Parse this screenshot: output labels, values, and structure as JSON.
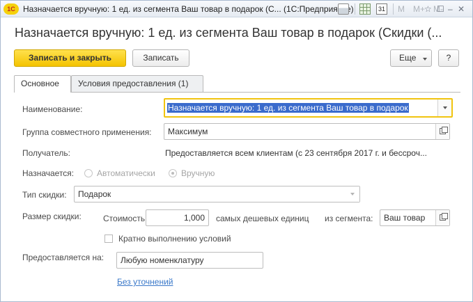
{
  "window": {
    "title": "Назначается вручную: 1 ед. из сегмента Ваш товар в подарок (С...  (1С:Предприятие)",
    "app_logo": "1С",
    "toolbar_icons": [
      "print-icon",
      "grid-icon",
      "calendar-icon"
    ],
    "calendar_day": "31",
    "memory_buttons": [
      "M",
      "M+",
      "M-"
    ],
    "system_buttons": [
      "☆",
      "☐",
      "–",
      "□",
      "✕"
    ]
  },
  "form": {
    "title": "Назначается вручную: 1 ед. из сегмента Ваш товар в подарок (Скидки (..."
  },
  "toolbar": {
    "save_close_label": "Записать и закрыть",
    "save_label": "Записать",
    "more_label": "Еще",
    "help_label": "?"
  },
  "tabs": [
    {
      "label": "Основное",
      "active": true
    },
    {
      "label": "Условия предоставления (1)",
      "active": false
    }
  ],
  "fields": {
    "name_label": "Наименование:",
    "name_value": "Назначается вручную: 1 ед. из сегмента Ваш товар в подарок",
    "group_label": "Группа совместного применения:",
    "group_value": "Максимум",
    "recipient_label": "Получатель:",
    "recipient_value": "Предоставляется всем клиентам (с 23 сентября 2017 г. и бессроч...",
    "assigned_label": "Назначается:",
    "assigned_options": [
      "Автоматически",
      "Вручную"
    ],
    "assigned_selected": "Вручную",
    "discount_type_label": "Тип скидки:",
    "discount_type_value": "Подарок",
    "discount_size_label": "Размер скидки:",
    "cost_label": "Стоимость",
    "cost_value": "1,000",
    "cheapest_units_label": "самых дешевых единиц",
    "segment_label": "из сегмента:",
    "segment_value": "Ваш товар",
    "multiple_label": "Кратно выполнению условий",
    "provided_for_label": "Предоставляется на:",
    "provided_for_value": "Любую номенклатуру",
    "refine_link": "Без уточнений"
  }
}
